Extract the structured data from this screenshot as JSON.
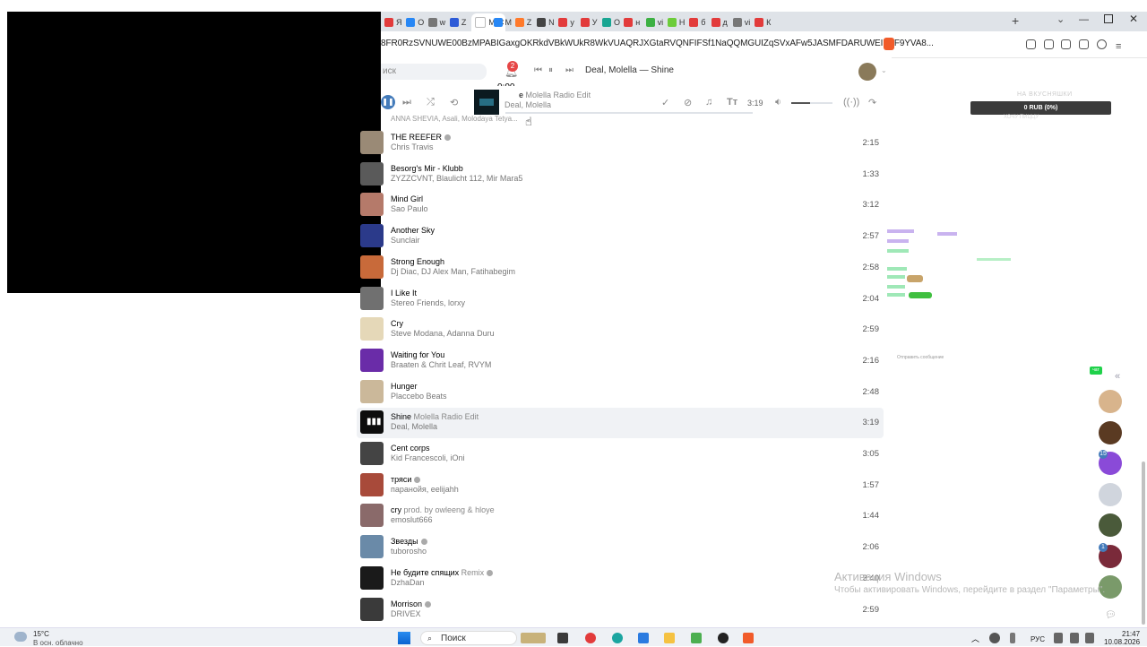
{
  "browser": {
    "tabs": [
      {
        "label": "Я",
        "color": "#e23b3b"
      },
      {
        "label": "О",
        "color": "#2787f5"
      },
      {
        "label": "w",
        "color": "#777777"
      },
      {
        "label": "Z",
        "color": "#2d5bd7"
      },
      {
        "label": "M",
        "color": "#ffffff",
        "active": true
      },
      {
        "label": "M",
        "color": "#2787f5"
      },
      {
        "label": "Z",
        "color": "#ff7a2b"
      },
      {
        "label": "N",
        "color": "#444444"
      },
      {
        "label": "у",
        "color": "#e23b3b"
      },
      {
        "label": "У",
        "color": "#e23b3b"
      },
      {
        "label": "О",
        "color": "#18a592"
      },
      {
        "label": "н",
        "color": "#e23b3b"
      },
      {
        "label": "vi",
        "color": "#3cb043"
      },
      {
        "label": "Н",
        "color": "#6ccc3a"
      },
      {
        "label": "б",
        "color": "#e23b3b"
      },
      {
        "label": "д",
        "color": "#e23b3b"
      },
      {
        "label": "vi",
        "color": "#777777"
      },
      {
        "label": "К",
        "color": "#e23b3b"
      }
    ],
    "url": "8FR0RzSVNUWE00BzMPABIGaxgOKRkdVBkWUkR8WkVUAQRJXGtaRVQNFIFSf1NaQQMGUIZqSVxAFw5JASMFDARUWEIKZF9YVA8..."
  },
  "vk": {
    "search_placeholder": "иск",
    "notification_count": "2",
    "mini_now_playing": "Deal, Molella — Shine",
    "mini_time": "0:00"
  },
  "player": {
    "title": "e",
    "subtitle": "Molella Radio Edit",
    "artist": "Deal, Molella",
    "duration": "3:19",
    "progress": 0.0,
    "volume": 0.45
  },
  "cut_row_text": "ANNA SHEVIA, Asali, Molodaya Tetya...",
  "tracks": [
    {
      "title": "THE REEFER",
      "sub": "",
      "explicit": true,
      "artist": "Chris Travis",
      "duration": "2:15",
      "thumb": "#9a8a76"
    },
    {
      "title": "Besorg's Mir - Klubb",
      "sub": "",
      "explicit": false,
      "artist": "ZYZZCVNT, Blaulicht 112, Mir Mara5",
      "duration": "1:33",
      "thumb": "#5a5a5a"
    },
    {
      "title": "Mind Girl",
      "sub": "",
      "explicit": false,
      "artist": "Sao Paulo",
      "duration": "3:12",
      "thumb": "#b57a6a"
    },
    {
      "title": "Another Sky",
      "sub": "",
      "explicit": false,
      "artist": "Sunclair",
      "duration": "2:57",
      "thumb": "#2b3a8a"
    },
    {
      "title": "Strong Enough",
      "sub": "",
      "explicit": false,
      "artist": "Dj Diac, DJ Alex Man, Fatihabegim",
      "duration": "2:58",
      "thumb": "#c86a3a"
    },
    {
      "title": "I Like It",
      "sub": "",
      "explicit": false,
      "artist": "Stereo Friends, lorxy",
      "duration": "2:04",
      "thumb": "#707070"
    },
    {
      "title": "Cry",
      "sub": "",
      "explicit": false,
      "artist": "Steve Modana, Adanna Duru",
      "duration": "2:59",
      "thumb": "#e5d8b8"
    },
    {
      "title": "Waiting for You",
      "sub": "",
      "explicit": false,
      "artist": "Braaten & Chrit Leaf, RVYM",
      "duration": "2:16",
      "thumb": "#6a2ca8"
    },
    {
      "title": "Hunger",
      "sub": "",
      "explicit": false,
      "artist": "Placcebo Beats",
      "duration": "2:48",
      "thumb": "#cbb89a"
    },
    {
      "title": "Shine",
      "sub": "Molella Radio Edit",
      "explicit": false,
      "artist": "Deal, Molella",
      "duration": "3:19",
      "thumb": "#0d0d0d",
      "active": true
    },
    {
      "title": "Cent corps",
      "sub": "",
      "explicit": false,
      "artist": "Kid Francescoli, iOni",
      "duration": "3:05",
      "thumb": "#444444"
    },
    {
      "title": "тряси",
      "sub": "",
      "explicit": true,
      "artist": "паранойя, eelijahh",
      "duration": "1:57",
      "thumb": "#a84a3a"
    },
    {
      "title": "cry",
      "sub": "prod. by owleeng & hloye",
      "explicit": false,
      "artist": "emoslut666",
      "duration": "1:44",
      "thumb": "#8a6a6a"
    },
    {
      "title": "Звезды",
      "sub": "",
      "explicit": true,
      "artist": "tuborosho",
      "duration": "2:06",
      "thumb": "#6a8aa8"
    },
    {
      "title": "Не будите спящих",
      "sub": "Remix",
      "explicit": true,
      "artist": "DzhaDan",
      "duration": "3:40",
      "thumb": "#1a1a1a"
    },
    {
      "title": "Morrison",
      "sub": "",
      "explicit": true,
      "artist": "DRIVEX",
      "duration": "2:59",
      "thumb": "#3a3a3a"
    }
  ],
  "right_panel": {
    "donation_top": "НА ВКУСНЯШКИ",
    "donation_bar": "0 RUB (0%)",
    "donation_bottom": "ХОЧУ ПИЦЦУ",
    "send_message": "Отправить сообщение",
    "chat_badge": "чат",
    "chat_colors": [
      "#a074e0",
      "#3bd36a",
      "#48c9a9"
    ]
  },
  "sidebar": {
    "avatars": [
      {
        "color": "#d8b48c",
        "badge": ""
      },
      {
        "color": "#5a3a22",
        "badge": ""
      },
      {
        "color": "#8a4ad8",
        "badge": "15"
      },
      {
        "color": "#d0d5dd",
        "badge": ""
      },
      {
        "color": "#4a5a3a",
        "badge": ""
      },
      {
        "color": "#7a2a3a",
        "badge": "1"
      },
      {
        "color": "#7a9a6a",
        "badge": ""
      }
    ]
  },
  "watermark": {
    "line1": "Активация Windows",
    "line2": "Чтобы активировать Windows, перейдите в раздел \"Параметры\"."
  },
  "taskbar": {
    "weather_temp": "15°C",
    "weather_status": "В осн. облачно",
    "search_label": "Поиск",
    "lang": "РУС",
    "time": "21:47",
    "date": "10.08.2026"
  }
}
